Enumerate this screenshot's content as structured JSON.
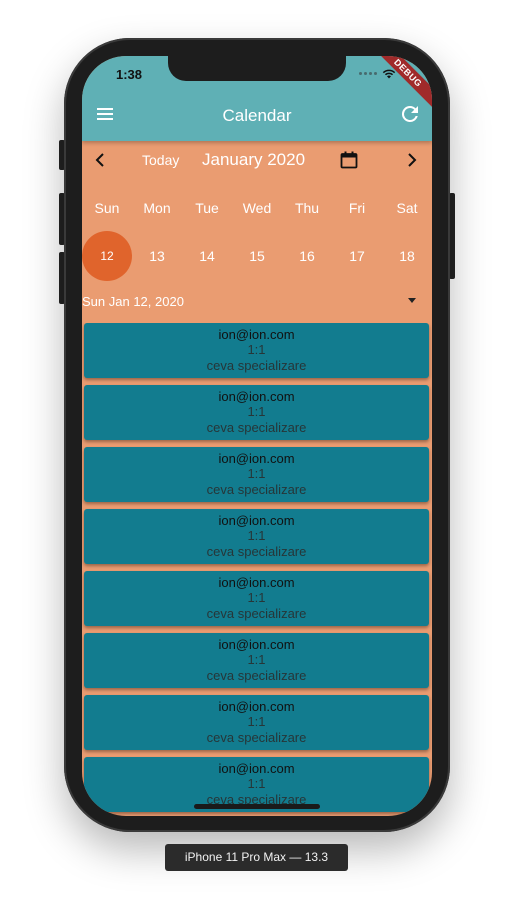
{
  "status_bar": {
    "time": "1:38",
    "debug_banner": "DEBUG"
  },
  "app_bar": {
    "title": "Calendar",
    "menu_icon": "hamburger-menu-icon",
    "refresh_icon": "refresh-icon",
    "background_color": "#5fb0b5"
  },
  "calendar": {
    "prev_icon": "chevron-left-icon",
    "next_icon": "chevron-right-icon",
    "today_label": "Today",
    "month_label": "January 2020",
    "calendar_icon": "calendar-icon",
    "weekdays": [
      "Sun",
      "Mon",
      "Tue",
      "Wed",
      "Thu",
      "Fri",
      "Sat"
    ],
    "dates": [
      "12",
      "13",
      "14",
      "15",
      "16",
      "17",
      "18"
    ],
    "selected_index": 0,
    "selected_color": "#e0642c",
    "background_color": "#ea9c71"
  },
  "selected_date": {
    "label": "Sun Jan 12, 2020",
    "dropdown_icon": "caret-down-icon"
  },
  "events": [
    {
      "email": "ion@ion.com",
      "time": "1:1",
      "specialization": "ceva specializare"
    },
    {
      "email": "ion@ion.com",
      "time": "1:1",
      "specialization": "ceva specializare"
    },
    {
      "email": "ion@ion.com",
      "time": "1:1",
      "specialization": "ceva specializare"
    },
    {
      "email": "ion@ion.com",
      "time": "1:1",
      "specialization": "ceva specializare"
    },
    {
      "email": "ion@ion.com",
      "time": "1:1",
      "specialization": "ceva specializare"
    },
    {
      "email": "ion@ion.com",
      "time": "1:1",
      "specialization": "ceva specializare"
    },
    {
      "email": "ion@ion.com",
      "time": "1:1",
      "specialization": "ceva specializare"
    },
    {
      "email": "ion@ion.com",
      "time": "1:1",
      "specialization": "ceva specializare"
    }
  ],
  "event_card_color": "#127c8f",
  "device_caption": "iPhone 11 Pro Max — 13.3"
}
